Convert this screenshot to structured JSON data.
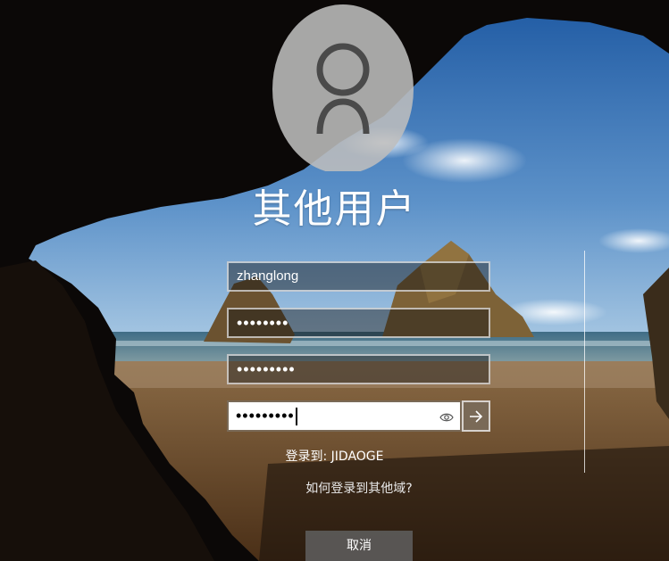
{
  "login": {
    "title": "其他用户",
    "username_value": "zhanglong",
    "password_mask_1": "••••••••",
    "password_mask_2": "•••••••••",
    "password_mask_3": "•••••••••",
    "signin_to": "登录到: JIDAOGE",
    "other_domain_link": "如何登录到其他域?",
    "cancel_label": "取消"
  },
  "icons": {
    "avatar": "user-avatar-icon",
    "reveal": "eye-icon",
    "submit": "arrow-right-icon"
  },
  "colors": {
    "avatar_bg": "#bdbdbd",
    "submit_bg": "#7a6a57",
    "cancel_bg": "#5f5f5f"
  }
}
